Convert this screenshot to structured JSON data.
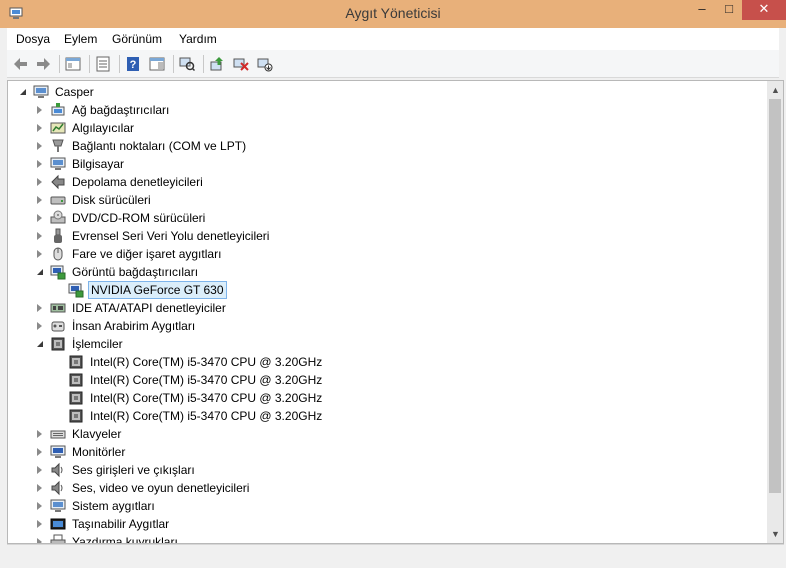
{
  "window": {
    "title": "Aygıt Yöneticisi",
    "controls": {
      "minimize": "–",
      "maximize": "□",
      "close": "✕"
    }
  },
  "menu": [
    "Dosya",
    "Eylem",
    "Görünüm",
    "Yardım"
  ],
  "toolbar": [
    "back-icon",
    "forward-icon",
    "show-hide-console-tree-icon",
    "properties-icon",
    "help-icon",
    "action-pane-icon",
    "scan-hardware-icon",
    "update-driver-icon",
    "uninstall-icon",
    "disable-icon"
  ],
  "tree": {
    "root": "Casper",
    "categories": [
      {
        "label": "Ağ bağdaştırıcıları",
        "icon": "network-adapter-icon",
        "expanded": false
      },
      {
        "label": "Algılayıcılar",
        "icon": "sensor-icon",
        "expanded": false
      },
      {
        "label": "Bağlantı noktaları (COM ve LPT)",
        "icon": "port-icon",
        "expanded": false
      },
      {
        "label": "Bilgisayar",
        "icon": "computer-icon",
        "expanded": false
      },
      {
        "label": "Depolama denetleyicileri",
        "icon": "storage-controller-icon",
        "expanded": false
      },
      {
        "label": "Disk sürücüleri",
        "icon": "disk-drive-icon",
        "expanded": false
      },
      {
        "label": "DVD/CD-ROM sürücüleri",
        "icon": "dvd-drive-icon",
        "expanded": false
      },
      {
        "label": "Evrensel Seri Veri Yolu denetleyicileri",
        "icon": "usb-icon",
        "expanded": false
      },
      {
        "label": "Fare ve diğer işaret aygıtları",
        "icon": "mouse-icon",
        "expanded": false
      },
      {
        "label": "Görüntü bağdaştırıcıları",
        "icon": "display-adapter-icon",
        "expanded": true,
        "children": [
          {
            "label": "NVIDIA GeForce GT 630",
            "icon": "display-adapter-icon",
            "selected": true
          }
        ]
      },
      {
        "label": "IDE ATA/ATAPI denetleyiciler",
        "icon": "ide-controller-icon",
        "expanded": false
      },
      {
        "label": "İnsan Arabirim Aygıtları",
        "icon": "hid-icon",
        "expanded": false
      },
      {
        "label": "İşlemciler",
        "icon": "processor-icon",
        "expanded": true,
        "children": [
          {
            "label": "Intel(R) Core(TM) i5-3470 CPU @ 3.20GHz",
            "icon": "processor-icon"
          },
          {
            "label": "Intel(R) Core(TM) i5-3470 CPU @ 3.20GHz",
            "icon": "processor-icon"
          },
          {
            "label": "Intel(R) Core(TM) i5-3470 CPU @ 3.20GHz",
            "icon": "processor-icon"
          },
          {
            "label": "Intel(R) Core(TM) i5-3470 CPU @ 3.20GHz",
            "icon": "processor-icon"
          }
        ]
      },
      {
        "label": "Klavyeler",
        "icon": "keyboard-icon",
        "expanded": false
      },
      {
        "label": "Monitörler",
        "icon": "monitor-icon",
        "expanded": false
      },
      {
        "label": "Ses girişleri ve çıkışları",
        "icon": "speaker-icon",
        "expanded": false
      },
      {
        "label": "Ses, video ve oyun denetleyicileri",
        "icon": "speaker-icon",
        "expanded": false
      },
      {
        "label": "Sistem aygıtları",
        "icon": "system-device-icon",
        "expanded": false
      },
      {
        "label": "Taşınabilir Aygıtlar",
        "icon": "portable-device-icon",
        "expanded": false
      },
      {
        "label": "Yazdırma kuyrukları",
        "icon": "printer-icon",
        "expanded": false
      }
    ]
  }
}
